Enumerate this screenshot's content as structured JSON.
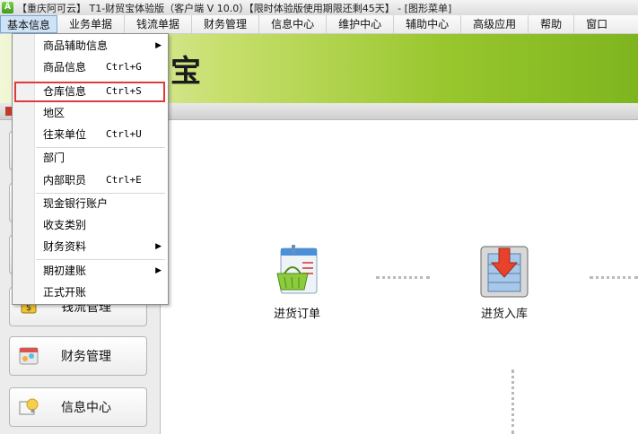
{
  "window": {
    "title": "【重庆阿可云】 T1-财贸宝体验版（客户端 V 10.0）【限时体验版使用期限还剩45天】 - [图形菜单]"
  },
  "menubar": {
    "items": [
      {
        "label": "基本信息"
      },
      {
        "label": "业务单据"
      },
      {
        "label": "钱流单据"
      },
      {
        "label": "财务管理"
      },
      {
        "label": "信息中心"
      },
      {
        "label": "维护中心"
      },
      {
        "label": "辅助中心"
      },
      {
        "label": "高级应用"
      },
      {
        "label": "帮助"
      },
      {
        "label": "窗口"
      }
    ]
  },
  "banner": {
    "logo_text": "宝"
  },
  "dropdown": {
    "items": [
      {
        "label": "商品辅助信息",
        "shortcut": "",
        "submenu": true
      },
      {
        "label": "商品信息",
        "shortcut": "Ctrl+G",
        "submenu": false
      },
      {
        "label": "仓库信息",
        "shortcut": "Ctrl+S",
        "submenu": false
      },
      {
        "label": "地区",
        "shortcut": "",
        "submenu": false
      },
      {
        "label": "往来单位",
        "shortcut": "Ctrl+U",
        "submenu": false
      },
      {
        "label": "部门",
        "shortcut": "",
        "submenu": false
      },
      {
        "label": "内部职员",
        "shortcut": "Ctrl+E",
        "submenu": false
      },
      {
        "label": "现金银行账户",
        "shortcut": "",
        "submenu": false
      },
      {
        "label": "收支类别",
        "shortcut": "",
        "submenu": false
      },
      {
        "label": "财务资料",
        "shortcut": "",
        "submenu": true
      },
      {
        "label": "期初建账",
        "shortcut": "",
        "submenu": true
      },
      {
        "label": "正式开账",
        "shortcut": "",
        "submenu": false
      }
    ],
    "submenu_arrow": "▶"
  },
  "sidebar": {
    "buttons": [
      {
        "label": "钱流管理"
      },
      {
        "label": "财务管理"
      },
      {
        "label": "信息中心"
      }
    ]
  },
  "flow": {
    "nodes": [
      {
        "label": "进货订单",
        "icon": "purchase-order-icon"
      },
      {
        "label": "进货入库",
        "icon": "stock-in-icon"
      }
    ]
  },
  "colors": {
    "highlight": "#e03a3a",
    "banner_green": "#98c62d",
    "menu_active": "#cfe3f7"
  }
}
